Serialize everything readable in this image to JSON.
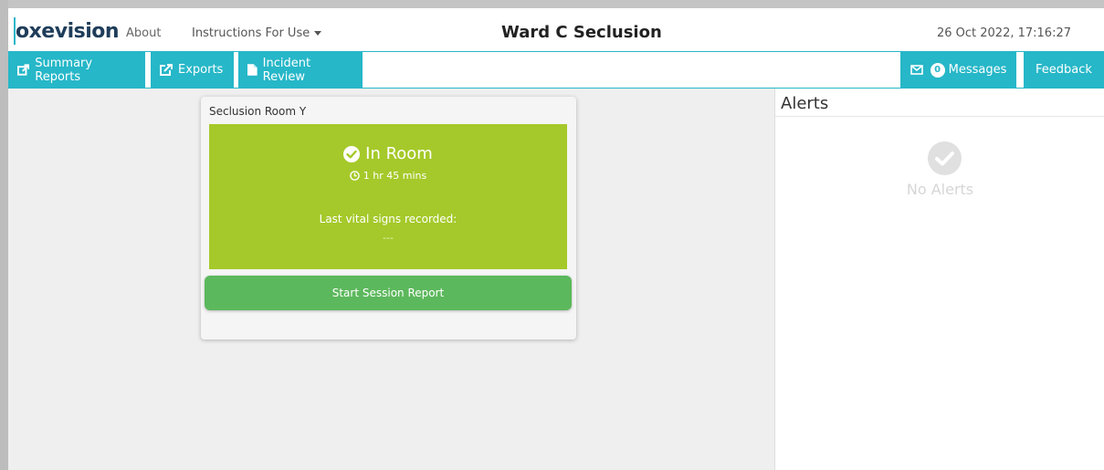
{
  "header": {
    "logo": "oxevision",
    "nav": {
      "about": "About",
      "instructions": "Instructions For Use"
    },
    "title": "Ward C Seclusion",
    "datetime": "26 Oct 2022, 17:16:27"
  },
  "toolbar": {
    "summary_reports": "Summary Reports",
    "exports": "Exports",
    "incident_review": "Incident Review",
    "messages_count": "0",
    "messages": "Messages",
    "feedback": "Feedback"
  },
  "room_card": {
    "title": "Seclusion Room Y",
    "status": "In Room",
    "duration": "1 hr 45 mins",
    "vitals_label": "Last vital signs recorded:",
    "vitals_value": "---",
    "start_button": "Start Session Report"
  },
  "alerts": {
    "title": "Alerts",
    "empty_message": "No Alerts"
  },
  "colors": {
    "accent": "#26b7c8",
    "status_green": "#a5c92a",
    "button_green": "#5cb85c"
  },
  "icons": {
    "summary": "share-square-icon",
    "exports": "external-link-icon",
    "incident": "file-icon",
    "messages": "envelope-icon",
    "status": "check-circle-icon",
    "duration": "clock-icon",
    "no_alerts": "check-circle-icon"
  }
}
